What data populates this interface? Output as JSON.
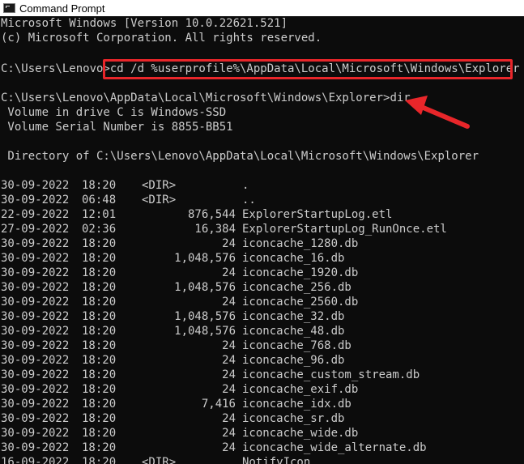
{
  "window": {
    "title": "Command Prompt"
  },
  "console": {
    "header_line1": "Microsoft Windows [Version 10.0.22621.521]",
    "header_line2": "(c) Microsoft Corporation. All rights reserved.",
    "prompt1": "C:\\Users\\Lenovo>",
    "command1": "cd /d %userprofile%\\AppData\\Local\\Microsoft\\Windows\\Explorer",
    "prompt2": "C:\\Users\\Lenovo\\AppData\\Local\\Microsoft\\Windows\\Explorer>",
    "command2": "dir",
    "volume_line": " Volume in drive C is Windows-SSD",
    "serial_line": " Volume Serial Number is 8855-BB51",
    "directory_line": " Directory of C:\\Users\\Lenovo\\AppData\\Local\\Microsoft\\Windows\\Explorer"
  },
  "annotation": {
    "highlight_color": "#e8262a"
  },
  "listing": [
    {
      "date": "30-09-2022",
      "time": "18:20",
      "dir": "<DIR>",
      "size": "",
      "name": "."
    },
    {
      "date": "30-09-2022",
      "time": "06:48",
      "dir": "<DIR>",
      "size": "",
      "name": ".."
    },
    {
      "date": "22-09-2022",
      "time": "12:01",
      "dir": "",
      "size": "876,544",
      "name": "ExplorerStartupLog.etl"
    },
    {
      "date": "27-09-2022",
      "time": "02:36",
      "dir": "",
      "size": "16,384",
      "name": "ExplorerStartupLog_RunOnce.etl"
    },
    {
      "date": "30-09-2022",
      "time": "18:20",
      "dir": "",
      "size": "24",
      "name": "iconcache_1280.db"
    },
    {
      "date": "30-09-2022",
      "time": "18:20",
      "dir": "",
      "size": "1,048,576",
      "name": "iconcache_16.db"
    },
    {
      "date": "30-09-2022",
      "time": "18:20",
      "dir": "",
      "size": "24",
      "name": "iconcache_1920.db"
    },
    {
      "date": "30-09-2022",
      "time": "18:20",
      "dir": "",
      "size": "1,048,576",
      "name": "iconcache_256.db"
    },
    {
      "date": "30-09-2022",
      "time": "18:20",
      "dir": "",
      "size": "24",
      "name": "iconcache_2560.db"
    },
    {
      "date": "30-09-2022",
      "time": "18:20",
      "dir": "",
      "size": "1,048,576",
      "name": "iconcache_32.db"
    },
    {
      "date": "30-09-2022",
      "time": "18:20",
      "dir": "",
      "size": "1,048,576",
      "name": "iconcache_48.db"
    },
    {
      "date": "30-09-2022",
      "time": "18:20",
      "dir": "",
      "size": "24",
      "name": "iconcache_768.db"
    },
    {
      "date": "30-09-2022",
      "time": "18:20",
      "dir": "",
      "size": "24",
      "name": "iconcache_96.db"
    },
    {
      "date": "30-09-2022",
      "time": "18:20",
      "dir": "",
      "size": "24",
      "name": "iconcache_custom_stream.db"
    },
    {
      "date": "30-09-2022",
      "time": "18:20",
      "dir": "",
      "size": "24",
      "name": "iconcache_exif.db"
    },
    {
      "date": "30-09-2022",
      "time": "18:20",
      "dir": "",
      "size": "7,416",
      "name": "iconcache_idx.db"
    },
    {
      "date": "30-09-2022",
      "time": "18:20",
      "dir": "",
      "size": "24",
      "name": "iconcache_sr.db"
    },
    {
      "date": "30-09-2022",
      "time": "18:20",
      "dir": "",
      "size": "24",
      "name": "iconcache_wide.db"
    },
    {
      "date": "30-09-2022",
      "time": "18:20",
      "dir": "",
      "size": "24",
      "name": "iconcache_wide_alternate.db"
    },
    {
      "date": "16-09-2022",
      "time": "18:20",
      "dir": "<DIR>",
      "size": "",
      "name": "NotifyIcon"
    }
  ]
}
